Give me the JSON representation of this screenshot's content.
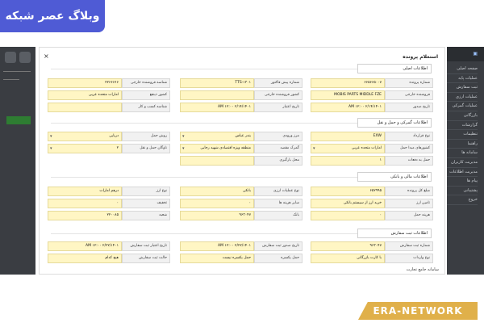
{
  "dialog": {
    "title": "استعلام پرونده",
    "close_glyph": "×"
  },
  "sections": {
    "s1": "اطلاعات اصلی",
    "s2": "اطلاعات گمرکی و حمل و نقل",
    "s3": "اطلاعات مالی و بانکی",
    "s4": "اطلاعات ثبت سفارش"
  },
  "fields": {
    "s1": [
      {
        "label": "شماره پرونده",
        "value": "۶۶۵۶۶۵۰۰۷"
      },
      {
        "label": "شماره پیش فاکتور",
        "value": "TTS-۱۳۰۱"
      },
      {
        "label": "شناسه فروشنده خارجی",
        "value": "۲۲۶۶۶۶۶"
      },
      {
        "label": "فروشنده خارجی",
        "value": "MOBIS PARTS MIDDLE FZE"
      },
      {
        "label": "کشور فروشنده خارجی",
        "value": ""
      },
      {
        "label": "کشور ذینفع",
        "value": "امارات متحده عربی"
      },
      {
        "label": "تاریخ صدور",
        "value": "AM ۱۲:۰۰ ۲/۱۴/۱۴۰۱"
      },
      {
        "label": "تاریخ اعتبار",
        "value": "AM ۱۲:۰۰ ۲/۱۴/۱۴۰۱"
      },
      {
        "label": "شناسه کسب و کار",
        "value": ""
      }
    ],
    "s2": [
      {
        "label": "نوع قرارداد",
        "value": "EXW"
      },
      {
        "label": "مرز ورودی",
        "value": "بندر عباس"
      },
      {
        "label": "روش حمل",
        "value": "دریایی"
      },
      {
        "label": "کشورهای مبدا حمل",
        "value": "امارات متحده عربی"
      },
      {
        "label": "گمرک مقصد",
        "value": "منطقه ویژه اقتصادی شهید رجایی"
      },
      {
        "label": "ناوگان حمل و نقل",
        "value": "۲"
      },
      {
        "label": "حمل به دفعات",
        "value": "۱"
      },
      {
        "label": "محل بارگیری",
        "value": ""
      }
    ],
    "s3": [
      {
        "label": "مبلغ کل پرونده",
        "value": "۶۵۲۹۹۵"
      },
      {
        "label": "نوع عملیات ارزی",
        "value": "بانکی"
      },
      {
        "label": "نوع ارز",
        "value": "درهم امارات"
      },
      {
        "label": "تامین ارز",
        "value": "خرید ارز از سیستم بانکی"
      },
      {
        "label": "سایر هزینه ها",
        "value": "۰"
      },
      {
        "label": "تخفیف",
        "value": "۰"
      },
      {
        "label": "هزینه حمل",
        "value": "۰"
      },
      {
        "label": "بانک",
        "value": "۹۶۳۰۴۷"
      },
      {
        "label": "شعبه",
        "value": "۲۲۰۰۸۵"
      }
    ],
    "s4": [
      {
        "label": "شماره ثبت سفارش",
        "value": "۹۶۳۰۴۷"
      },
      {
        "label": "تاریخ صدور ثبت سفارش",
        "value": "AM ۱۲:۰۰ ۲/۲۲/۱۴۰۱"
      },
      {
        "label": "تاریخ اعتبار ثبت سفارش",
        "value": "AM ۱۲:۰۰ ۲/۲۲/۱۴۰۱"
      },
      {
        "label": "نوع واردات",
        "value": "با کارت بازرگانی"
      },
      {
        "label": "حمل یکسره",
        "value": "حمل یکسره نیست"
      },
      {
        "label": "حالت ثبت سفارش",
        "value": "هیچ کدام"
      }
    ]
  },
  "bottom_partial": "سامانه جامع تجارت",
  "side_menu": [
    "صفحه اصلی",
    "عملیات پایه",
    "ثبت سفارش",
    "عملیات ارزی",
    "عملیات گمرکی",
    "بازرگانی",
    "گزارشات",
    "تنظیمات",
    "راهنما",
    "سامانه ها",
    "مدیریت کاربران",
    "مدیریت اطلاعات",
    "پیام ها",
    "پشتیبانی",
    "خروج"
  ],
  "badges": {
    "top": "وبلاگ عصر شبکه",
    "bottom": "ERA-NETWORK"
  }
}
